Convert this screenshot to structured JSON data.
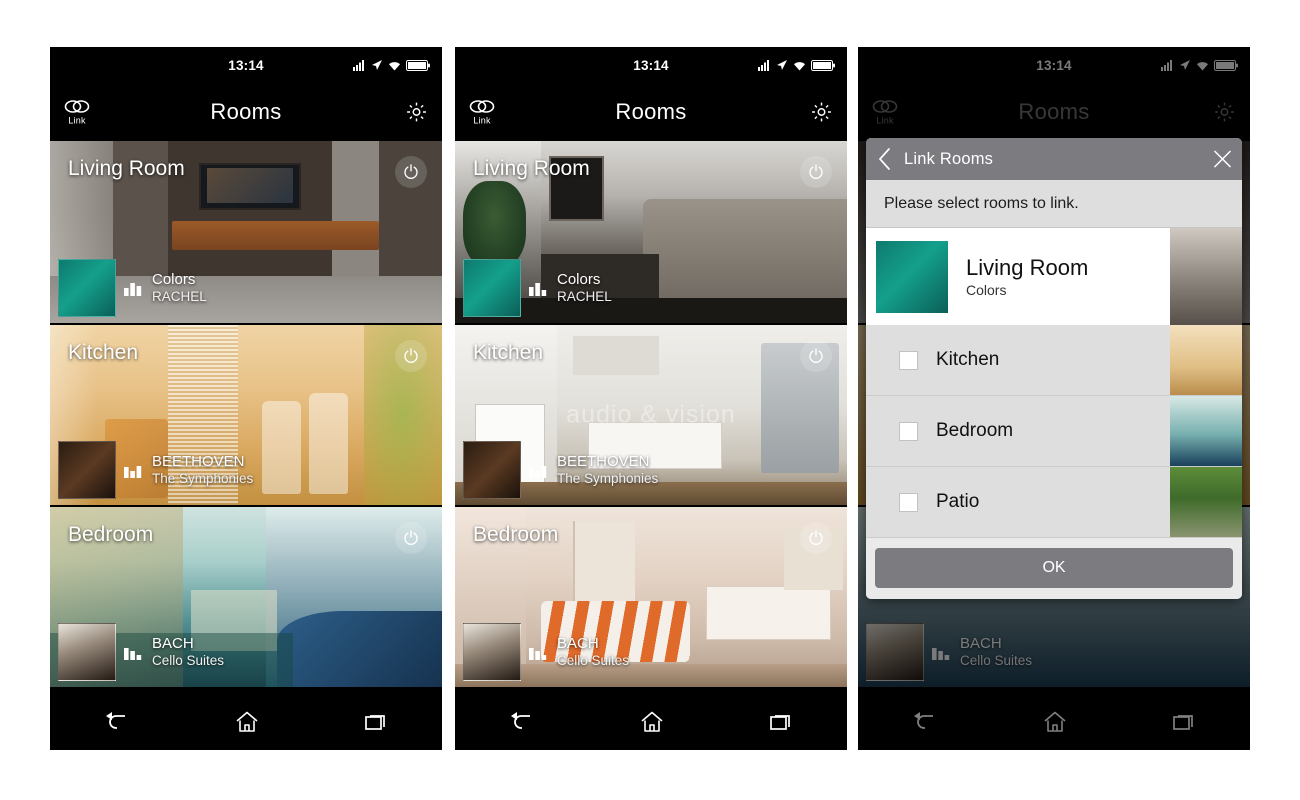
{
  "status_bar": {
    "time": "13:14",
    "icons": [
      "signal-icon",
      "location-icon",
      "wifi-icon",
      "battery-icon"
    ]
  },
  "app_bar": {
    "title": "Rooms",
    "link_label": "Link",
    "link_icon": "link-icon",
    "settings_icon": "gear-icon"
  },
  "nav_bar": {
    "back_icon": "back-arrow-icon",
    "home_icon": "home-icon",
    "recents_icon": "recents-icon"
  },
  "rooms": [
    {
      "name": "Living Room",
      "track_title": "Colors",
      "track_artist": "RACHEL",
      "power_icon": "power-icon",
      "eq_icon": "equalizer-icon"
    },
    {
      "name": "Kitchen",
      "track_title": "BEETHOVEN",
      "track_artist": "The Symphonies",
      "power_icon": "power-icon",
      "eq_icon": "equalizer-icon"
    },
    {
      "name": "Bedroom",
      "track_title": "BACH",
      "track_artist": "Cello Suites",
      "power_icon": "power-icon",
      "eq_icon": "equalizer-icon"
    }
  ],
  "watermark": "audio & vision",
  "dialog": {
    "title": "Link Rooms",
    "back_icon": "chevron-left-icon",
    "close_icon": "close-icon",
    "prompt": "Please select rooms to link.",
    "ok_label": "OK",
    "rows": [
      {
        "name": "Living Room",
        "subtitle": "Colors",
        "selected": true,
        "checkbox": "checkbox-unchecked"
      },
      {
        "name": "Kitchen",
        "subtitle": "",
        "selected": false,
        "checkbox": "checkbox-unchecked"
      },
      {
        "name": "Bedroom",
        "subtitle": "",
        "selected": false,
        "checkbox": "checkbox-unchecked"
      },
      {
        "name": "Patio",
        "subtitle": "",
        "selected": false,
        "checkbox": "checkbox-unchecked"
      }
    ]
  },
  "colors": {
    "page_background": "#ffffff",
    "phone_background": "#000000",
    "dialog_header": "#7b7b80",
    "dialog_body": "#dedede",
    "dialog_active_row": "#ffffff",
    "ok_button": "#7b7b80"
  }
}
